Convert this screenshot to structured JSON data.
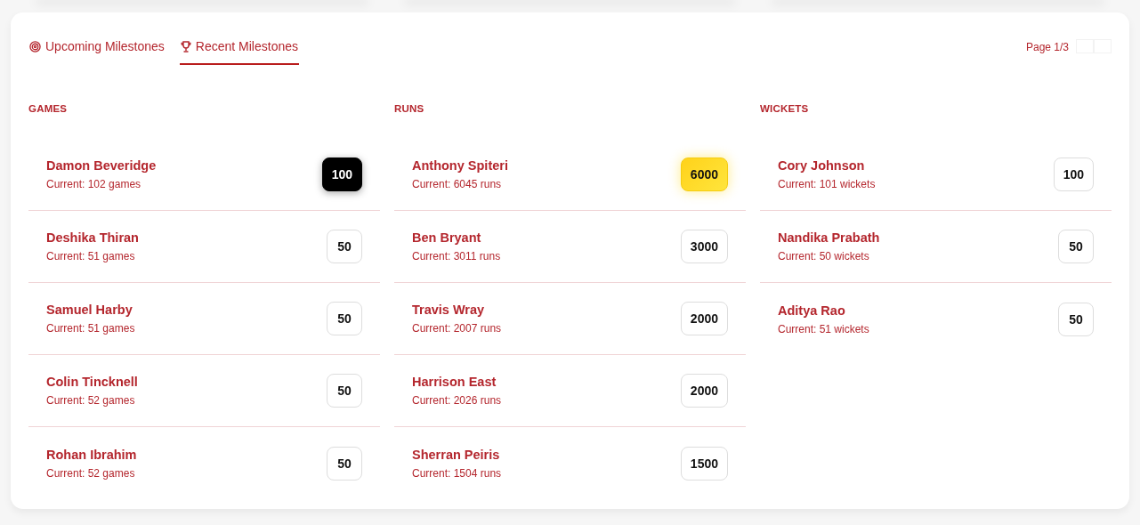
{
  "tabs": [
    {
      "label": "Upcoming Milestones",
      "selected": false
    },
    {
      "label": "Recent Milestones",
      "selected": true
    }
  ],
  "pager": {
    "label": "Page 1/3"
  },
  "columns": [
    {
      "heading": "GAMES",
      "rows": [
        {
          "name": "Damon Beveridge",
          "current": "Current: 102 games",
          "milestone": "100",
          "kind": "dark"
        },
        {
          "name": "Deshika Thiran",
          "current": "Current: 51 games",
          "milestone": "50",
          "kind": "plain"
        },
        {
          "name": "Samuel Harby",
          "current": "Current: 51 games",
          "milestone": "50",
          "kind": "plain"
        },
        {
          "name": "Colin Tincknell",
          "current": "Current: 52 games",
          "milestone": "50",
          "kind": "plain"
        },
        {
          "name": "Rohan Ibrahim",
          "current": "Current: 52 games",
          "milestone": "50",
          "kind": "plain"
        }
      ]
    },
    {
      "heading": "RUNS",
      "rows": [
        {
          "name": "Anthony Spiteri",
          "current": "Current: 6045 runs",
          "milestone": "6000",
          "kind": "gold"
        },
        {
          "name": "Ben Bryant",
          "current": "Current: 3011 runs",
          "milestone": "3000",
          "kind": "plain"
        },
        {
          "name": "Travis Wray",
          "current": "Current: 2007 runs",
          "milestone": "2000",
          "kind": "plain"
        },
        {
          "name": "Harrison East",
          "current": "Current: 2026 runs",
          "milestone": "2000",
          "kind": "plain"
        },
        {
          "name": "Sherran Peiris",
          "current": "Current: 1504 runs",
          "milestone": "1500",
          "kind": "plain"
        }
      ]
    },
    {
      "heading": "WICKETS",
      "rows": [
        {
          "name": "Cory Johnson",
          "current": "Current: 101 wickets",
          "milestone": "100",
          "kind": "plain"
        },
        {
          "name": "Nandika Prabath",
          "current": "Current: 50 wickets",
          "milestone": "50",
          "kind": "plain"
        },
        {
          "name": "Aditya Rao",
          "current": "Current: 51 wickets",
          "milestone": "50",
          "kind": "plain"
        }
      ]
    }
  ]
}
